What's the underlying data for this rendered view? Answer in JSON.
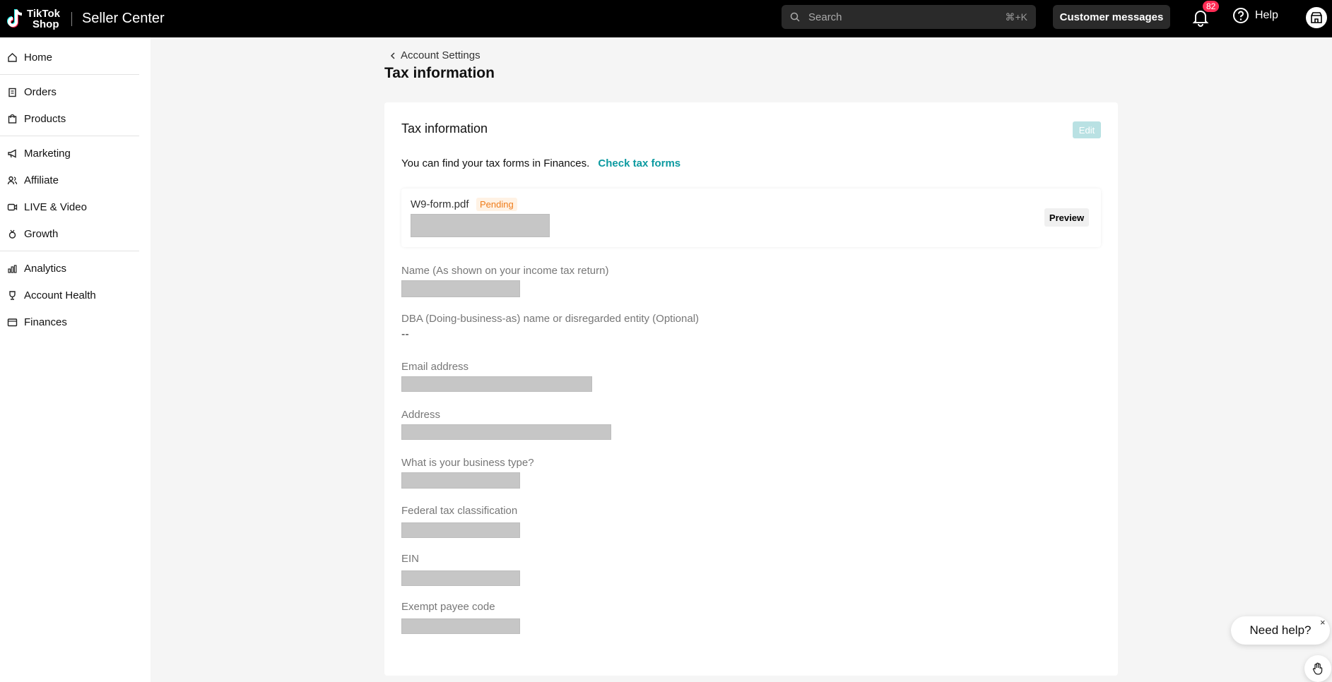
{
  "header": {
    "logo_line1": "TikTok",
    "logo_line2": "Shop",
    "app_title": "Seller Center",
    "search_placeholder": "Search",
    "search_shortcut": "⌘+K",
    "customer_messages": "Customer messages",
    "notification_count": "82",
    "help": "Help"
  },
  "sidebar": {
    "items": [
      {
        "label": "Home",
        "icon": "home-icon"
      },
      {
        "label": "Orders",
        "icon": "clipboard-icon"
      },
      {
        "label": "Products",
        "icon": "bag-icon"
      },
      {
        "label": "Marketing",
        "icon": "megaphone-icon"
      },
      {
        "label": "Affiliate",
        "icon": "users-icon"
      },
      {
        "label": "LIVE & Video",
        "icon": "video-icon"
      },
      {
        "label": "Growth",
        "icon": "medal-icon"
      },
      {
        "label": "Analytics",
        "icon": "chart-icon"
      },
      {
        "label": "Account Health",
        "icon": "trophy-icon"
      },
      {
        "label": "Finances",
        "icon": "wallet-icon"
      }
    ]
  },
  "main": {
    "breadcrumb": "Account Settings",
    "page_title": "Tax information",
    "card": {
      "title": "Tax information",
      "edit": "Edit",
      "info_text": "You can find your tax forms in Finances.",
      "info_link": "Check tax forms",
      "file_name": "W9-form.pdf",
      "file_status": "Pending",
      "preview": "Preview",
      "fields": [
        {
          "label": "Name (As shown on your income tax return)"
        },
        {
          "label": "DBA (Doing-business-as) name or disregarded entity (Optional)",
          "value": "--"
        },
        {
          "label": "Email address"
        },
        {
          "label": "Address"
        },
        {
          "label": "What is your business type?"
        },
        {
          "label": "Federal tax classification"
        },
        {
          "label": "EIN"
        },
        {
          "label": "Exempt payee code"
        }
      ]
    }
  },
  "widget": {
    "need_help": "Need help?",
    "close": "×"
  },
  "colors": {
    "accent": "#0c9aa0",
    "pending": "#ef7c1a",
    "badge": "#fe2c55"
  }
}
